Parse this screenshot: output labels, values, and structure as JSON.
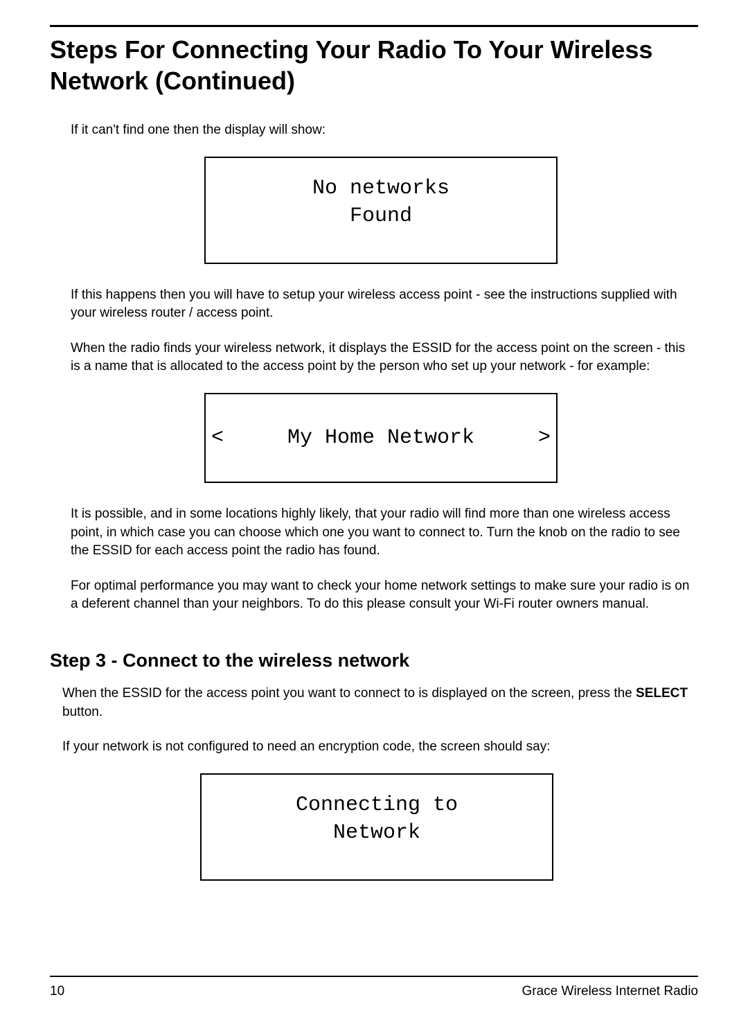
{
  "title": "Steps For Connecting Your Radio To Your Wireless Network (Continued)",
  "para1": "If it can't find one then the display will show:",
  "display1": "No networks\nFound",
  "para2": "If this happens then you will have to setup your wireless access point - see the instructions supplied with your wireless router / access point.",
  "para3": "When the radio finds your wireless network, it displays the ESSID for the access point on the screen - this is a name that is allocated to the access point by the person who set up your network - for example:",
  "display2": {
    "left": "<",
    "text": "My Home Network",
    "right": ">"
  },
  "para4": "It is possible, and in some locations highly likely, that your radio will find more than one wireless access point, in which case you can choose which one you want to connect to. Turn the knob on the radio to see the ESSID for each access point the radio has found.",
  "para5": "For optimal performance you may want to check your home network settings to make sure your radio is on a deferent channel than your neighbors. To do this please consult your Wi-Fi router owners manual.",
  "step3_heading": "Step 3 - Connect to the wireless network",
  "para6_prefix": "When the ESSID for the access point you want to connect to is displayed on the screen, press the ",
  "para6_bold": "SELECT",
  "para6_suffix": " button.",
  "para7": "If your network is not configured to need an encryption code, the screen should say:",
  "display3": "Connecting to\nNetwork",
  "footer": {
    "page": "10",
    "title": "Grace Wireless Internet Radio"
  }
}
